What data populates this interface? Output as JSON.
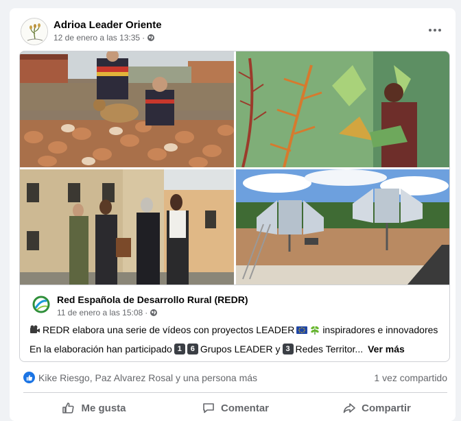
{
  "post": {
    "page_name": "Adrioa Leader Oriente",
    "timestamp": "12 de enero a las 13:35",
    "sep": "·",
    "privacy_icon": "globe-icon",
    "more_icon": "more-horizontal-icon"
  },
  "shared_post": {
    "page_name": "Red Española de Desarrollo Rural (REDR)",
    "timestamp": "11 de enero a las 15:08",
    "sep": "·",
    "line1": {
      "part1": "REDR elabora una serie de vídeos con proyectos LEADER",
      "part2": "inspiradores e innovadores"
    },
    "line2": {
      "part1": "En la elaboración han participado",
      "num1": "1",
      "num2": "6",
      "part2": "Grupos LEADER y",
      "num3": "3",
      "part3": "Redes Territor...",
      "see_more": "Ver más"
    }
  },
  "stats": {
    "reactors": "Kike Riesgo, Paz Alvarez Rosal y una persona más",
    "shares": "1 vez compartido"
  },
  "actions": {
    "like": "Me gusta",
    "comment": "Comentar",
    "share": "Compartir"
  },
  "colors": {
    "accent": "#1b74e4",
    "muted_text": "#65676b",
    "divider": "#ced0d4"
  }
}
